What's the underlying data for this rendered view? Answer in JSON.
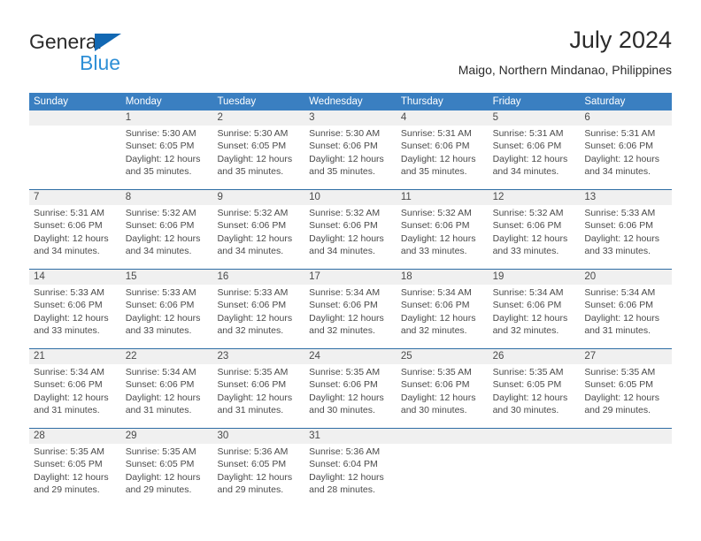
{
  "brand": {
    "name_part1": "General",
    "name_part2": "Blue",
    "colors": {
      "triangle": "#1268b3",
      "blue_text": "#2e8fd6",
      "dark_text": "#2b2b2b"
    }
  },
  "header": {
    "title": "July 2024",
    "subtitle": "Maigo, Northern Mindanao, Philippines"
  },
  "calendar": {
    "accent_color": "#3a7fc1",
    "date_strip_color": "#f0f0f0",
    "separator_color": "#2e6da4",
    "weekday_headers": [
      "Sunday",
      "Monday",
      "Tuesday",
      "Wednesday",
      "Thursday",
      "Friday",
      "Saturday"
    ],
    "weeks": [
      [
        {
          "date": "",
          "sunrise": "",
          "sunset": "",
          "daylight_line1": "",
          "daylight_line2": "",
          "empty": true
        },
        {
          "date": "1",
          "sunrise": "Sunrise: 5:30 AM",
          "sunset": "Sunset: 6:05 PM",
          "daylight_line1": "Daylight: 12 hours",
          "daylight_line2": "and 35 minutes."
        },
        {
          "date": "2",
          "sunrise": "Sunrise: 5:30 AM",
          "sunset": "Sunset: 6:05 PM",
          "daylight_line1": "Daylight: 12 hours",
          "daylight_line2": "and 35 minutes."
        },
        {
          "date": "3",
          "sunrise": "Sunrise: 5:30 AM",
          "sunset": "Sunset: 6:06 PM",
          "daylight_line1": "Daylight: 12 hours",
          "daylight_line2": "and 35 minutes."
        },
        {
          "date": "4",
          "sunrise": "Sunrise: 5:31 AM",
          "sunset": "Sunset: 6:06 PM",
          "daylight_line1": "Daylight: 12 hours",
          "daylight_line2": "and 35 minutes."
        },
        {
          "date": "5",
          "sunrise": "Sunrise: 5:31 AM",
          "sunset": "Sunset: 6:06 PM",
          "daylight_line1": "Daylight: 12 hours",
          "daylight_line2": "and 34 minutes."
        },
        {
          "date": "6",
          "sunrise": "Sunrise: 5:31 AM",
          "sunset": "Sunset: 6:06 PM",
          "daylight_line1": "Daylight: 12 hours",
          "daylight_line2": "and 34 minutes."
        }
      ],
      [
        {
          "date": "7",
          "sunrise": "Sunrise: 5:31 AM",
          "sunset": "Sunset: 6:06 PM",
          "daylight_line1": "Daylight: 12 hours",
          "daylight_line2": "and 34 minutes."
        },
        {
          "date": "8",
          "sunrise": "Sunrise: 5:32 AM",
          "sunset": "Sunset: 6:06 PM",
          "daylight_line1": "Daylight: 12 hours",
          "daylight_line2": "and 34 minutes."
        },
        {
          "date": "9",
          "sunrise": "Sunrise: 5:32 AM",
          "sunset": "Sunset: 6:06 PM",
          "daylight_line1": "Daylight: 12 hours",
          "daylight_line2": "and 34 minutes."
        },
        {
          "date": "10",
          "sunrise": "Sunrise: 5:32 AM",
          "sunset": "Sunset: 6:06 PM",
          "daylight_line1": "Daylight: 12 hours",
          "daylight_line2": "and 34 minutes."
        },
        {
          "date": "11",
          "sunrise": "Sunrise: 5:32 AM",
          "sunset": "Sunset: 6:06 PM",
          "daylight_line1": "Daylight: 12 hours",
          "daylight_line2": "and 33 minutes."
        },
        {
          "date": "12",
          "sunrise": "Sunrise: 5:32 AM",
          "sunset": "Sunset: 6:06 PM",
          "daylight_line1": "Daylight: 12 hours",
          "daylight_line2": "and 33 minutes."
        },
        {
          "date": "13",
          "sunrise": "Sunrise: 5:33 AM",
          "sunset": "Sunset: 6:06 PM",
          "daylight_line1": "Daylight: 12 hours",
          "daylight_line2": "and 33 minutes."
        }
      ],
      [
        {
          "date": "14",
          "sunrise": "Sunrise: 5:33 AM",
          "sunset": "Sunset: 6:06 PM",
          "daylight_line1": "Daylight: 12 hours",
          "daylight_line2": "and 33 minutes."
        },
        {
          "date": "15",
          "sunrise": "Sunrise: 5:33 AM",
          "sunset": "Sunset: 6:06 PM",
          "daylight_line1": "Daylight: 12 hours",
          "daylight_line2": "and 33 minutes."
        },
        {
          "date": "16",
          "sunrise": "Sunrise: 5:33 AM",
          "sunset": "Sunset: 6:06 PM",
          "daylight_line1": "Daylight: 12 hours",
          "daylight_line2": "and 32 minutes."
        },
        {
          "date": "17",
          "sunrise": "Sunrise: 5:34 AM",
          "sunset": "Sunset: 6:06 PM",
          "daylight_line1": "Daylight: 12 hours",
          "daylight_line2": "and 32 minutes."
        },
        {
          "date": "18",
          "sunrise": "Sunrise: 5:34 AM",
          "sunset": "Sunset: 6:06 PM",
          "daylight_line1": "Daylight: 12 hours",
          "daylight_line2": "and 32 minutes."
        },
        {
          "date": "19",
          "sunrise": "Sunrise: 5:34 AM",
          "sunset": "Sunset: 6:06 PM",
          "daylight_line1": "Daylight: 12 hours",
          "daylight_line2": "and 32 minutes."
        },
        {
          "date": "20",
          "sunrise": "Sunrise: 5:34 AM",
          "sunset": "Sunset: 6:06 PM",
          "daylight_line1": "Daylight: 12 hours",
          "daylight_line2": "and 31 minutes."
        }
      ],
      [
        {
          "date": "21",
          "sunrise": "Sunrise: 5:34 AM",
          "sunset": "Sunset: 6:06 PM",
          "daylight_line1": "Daylight: 12 hours",
          "daylight_line2": "and 31 minutes."
        },
        {
          "date": "22",
          "sunrise": "Sunrise: 5:34 AM",
          "sunset": "Sunset: 6:06 PM",
          "daylight_line1": "Daylight: 12 hours",
          "daylight_line2": "and 31 minutes."
        },
        {
          "date": "23",
          "sunrise": "Sunrise: 5:35 AM",
          "sunset": "Sunset: 6:06 PM",
          "daylight_line1": "Daylight: 12 hours",
          "daylight_line2": "and 31 minutes."
        },
        {
          "date": "24",
          "sunrise": "Sunrise: 5:35 AM",
          "sunset": "Sunset: 6:06 PM",
          "daylight_line1": "Daylight: 12 hours",
          "daylight_line2": "and 30 minutes."
        },
        {
          "date": "25",
          "sunrise": "Sunrise: 5:35 AM",
          "sunset": "Sunset: 6:06 PM",
          "daylight_line1": "Daylight: 12 hours",
          "daylight_line2": "and 30 minutes."
        },
        {
          "date": "26",
          "sunrise": "Sunrise: 5:35 AM",
          "sunset": "Sunset: 6:05 PM",
          "daylight_line1": "Daylight: 12 hours",
          "daylight_line2": "and 30 minutes."
        },
        {
          "date": "27",
          "sunrise": "Sunrise: 5:35 AM",
          "sunset": "Sunset: 6:05 PM",
          "daylight_line1": "Daylight: 12 hours",
          "daylight_line2": "and 29 minutes."
        }
      ],
      [
        {
          "date": "28",
          "sunrise": "Sunrise: 5:35 AM",
          "sunset": "Sunset: 6:05 PM",
          "daylight_line1": "Daylight: 12 hours",
          "daylight_line2": "and 29 minutes."
        },
        {
          "date": "29",
          "sunrise": "Sunrise: 5:35 AM",
          "sunset": "Sunset: 6:05 PM",
          "daylight_line1": "Daylight: 12 hours",
          "daylight_line2": "and 29 minutes."
        },
        {
          "date": "30",
          "sunrise": "Sunrise: 5:36 AM",
          "sunset": "Sunset: 6:05 PM",
          "daylight_line1": "Daylight: 12 hours",
          "daylight_line2": "and 29 minutes."
        },
        {
          "date": "31",
          "sunrise": "Sunrise: 5:36 AM",
          "sunset": "Sunset: 6:04 PM",
          "daylight_line1": "Daylight: 12 hours",
          "daylight_line2": "and 28 minutes."
        },
        {
          "date": "",
          "sunrise": "",
          "sunset": "",
          "daylight_line1": "",
          "daylight_line2": "",
          "empty": true
        },
        {
          "date": "",
          "sunrise": "",
          "sunset": "",
          "daylight_line1": "",
          "daylight_line2": "",
          "empty": true
        },
        {
          "date": "",
          "sunrise": "",
          "sunset": "",
          "daylight_line1": "",
          "daylight_line2": "",
          "empty": true
        }
      ]
    ]
  }
}
